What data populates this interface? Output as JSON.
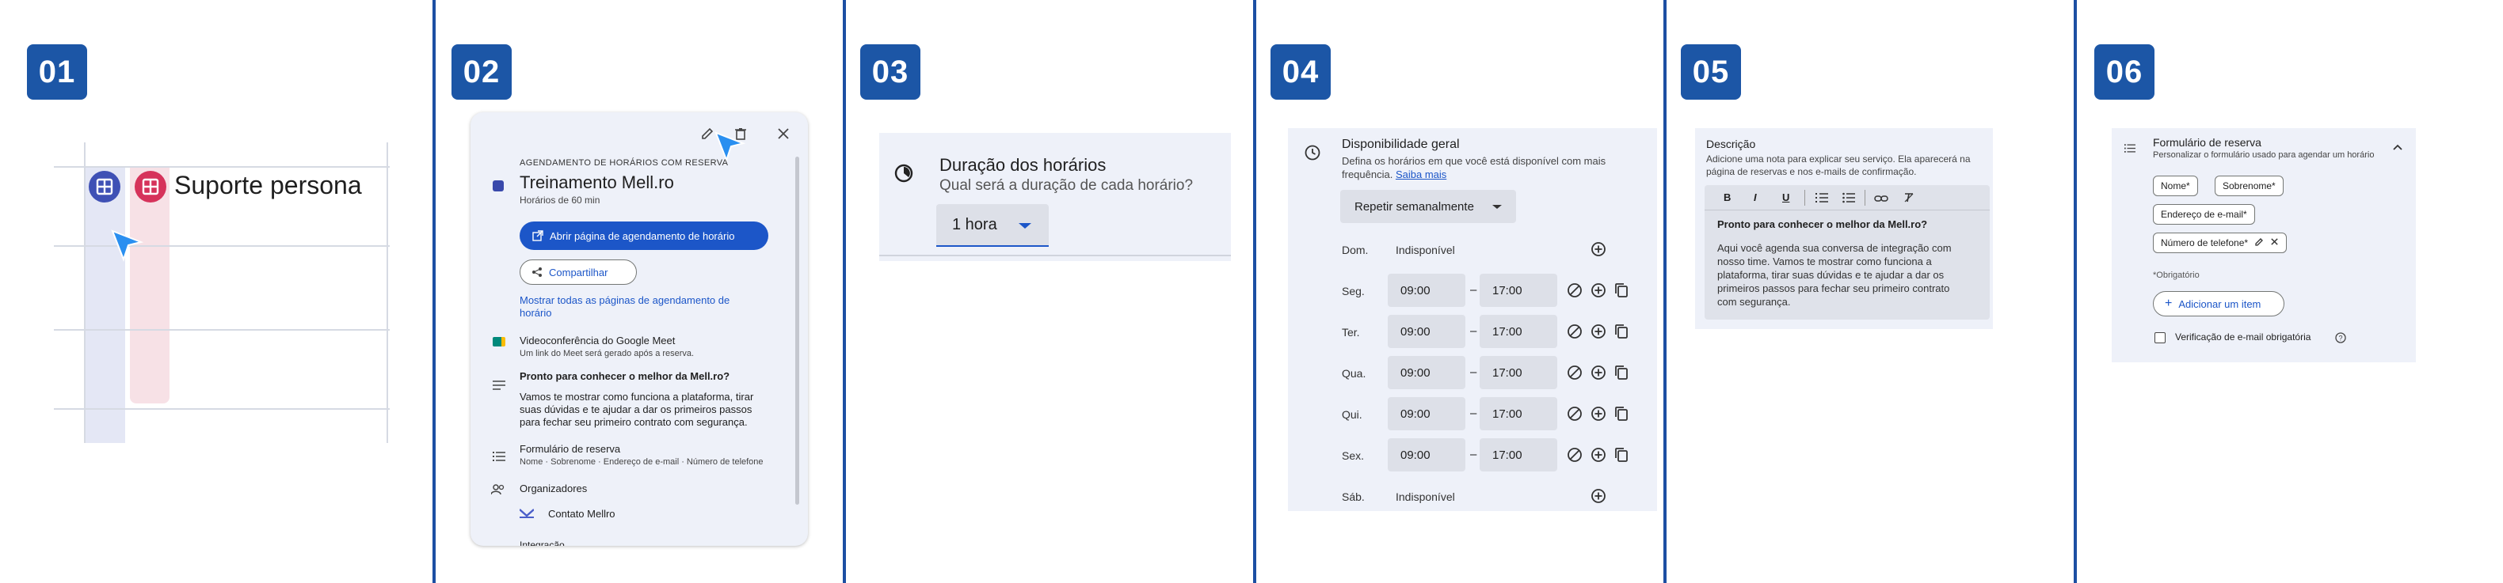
{
  "steps": [
    "01",
    "02",
    "03",
    "04",
    "05",
    "06"
  ],
  "panel1": {
    "calendar_title": "Suporte persona"
  },
  "panel2": {
    "heading": "AGENDAMENTO DE HORÁRIOS COM RESERVA",
    "title": "Treinamento Mell.ro",
    "duration": "Horários de 60 min",
    "open_button": "Abrir página de agendamento de horário",
    "share_button": "Compartilhar",
    "show_all_link_1": "Mostrar todas as páginas de agendamento de",
    "show_all_link_2": "horário",
    "meet_title": "Videoconferência do Google Meet",
    "meet_sub": "Um link do Meet será gerado após a reserva.",
    "desc_title": "Pronto para conhecer o melhor da Mell.ro?",
    "desc_lines": [
      "Vamos te mostrar como funciona a plataforma, tirar",
      "suas dúvidas e te ajudar a dar os primeiros passos",
      "para fechar seu primeiro contrato com segurança."
    ],
    "form_title": "Formulário de reserva",
    "form_fields": "Nome · Sobrenome · Endereço de e-mail · Número de telefone",
    "organizers": "Organizadores",
    "organizer_name": "Contato Mellro",
    "cut_text": "Integração"
  },
  "panel3": {
    "title": "Duração dos horários",
    "subtitle": "Qual será a duração de cada horário?",
    "select_value": "1 hora"
  },
  "panel4": {
    "title": "Disponibilidade geral",
    "desc_line1": "Defina os horários em que você está disponível com mais",
    "desc_line2": "frequência.",
    "learn_more": "Saiba mais",
    "repeat": "Repetir semanalmente",
    "unavailable": "Indisponível",
    "dash": "–",
    "days": [
      {
        "day": "Dom.",
        "start": "",
        "end": ""
      },
      {
        "day": "Seg.",
        "start": "09:00",
        "end": "17:00"
      },
      {
        "day": "Ter.",
        "start": "09:00",
        "end": "17:00"
      },
      {
        "day": "Qua.",
        "start": "09:00",
        "end": "17:00"
      },
      {
        "day": "Qui.",
        "start": "09:00",
        "end": "17:00"
      },
      {
        "day": "Sex.",
        "start": "09:00",
        "end": "17:00"
      },
      {
        "day": "Sáb.",
        "start": "",
        "end": ""
      }
    ]
  },
  "panel5": {
    "title": "Descrição",
    "desc_line1": "Adicione uma nota para explicar seu serviço. Ela aparecerá na",
    "desc_line2": "página de reservas e nos e-mails de confirmação.",
    "toolbar": {
      "bold": "B",
      "italic": "I",
      "underline": "U"
    },
    "body_title": "Pronto para conhecer o melhor da Mell.ro?",
    "body_lines": [
      "Aqui você agenda sua conversa de integração com",
      "nosso time. Vamos te mostrar como funciona a",
      "plataforma, tirar suas dúvidas e te ajudar a dar os",
      "primeiros passos para fechar seu primeiro contrato",
      "com segurança."
    ]
  },
  "panel6": {
    "title": "Formulário de reserva",
    "subtitle": "Personalizar o formulário usado para agendar um horário",
    "chip_name": "Nome*",
    "chip_surname": "Sobrenome*",
    "chip_email": "Endereço de e-mail*",
    "chip_phone": "Número de telefone*",
    "required_note": "*Obrigatório",
    "add_item": "Adicionar um item",
    "verify_email": "Verificação de e-mail obrigatória"
  },
  "colors": {
    "accent": "#1c56a6",
    "divider": "#1c4fa3",
    "card_bg": "#eef1f9",
    "link": "#1c56c8"
  }
}
